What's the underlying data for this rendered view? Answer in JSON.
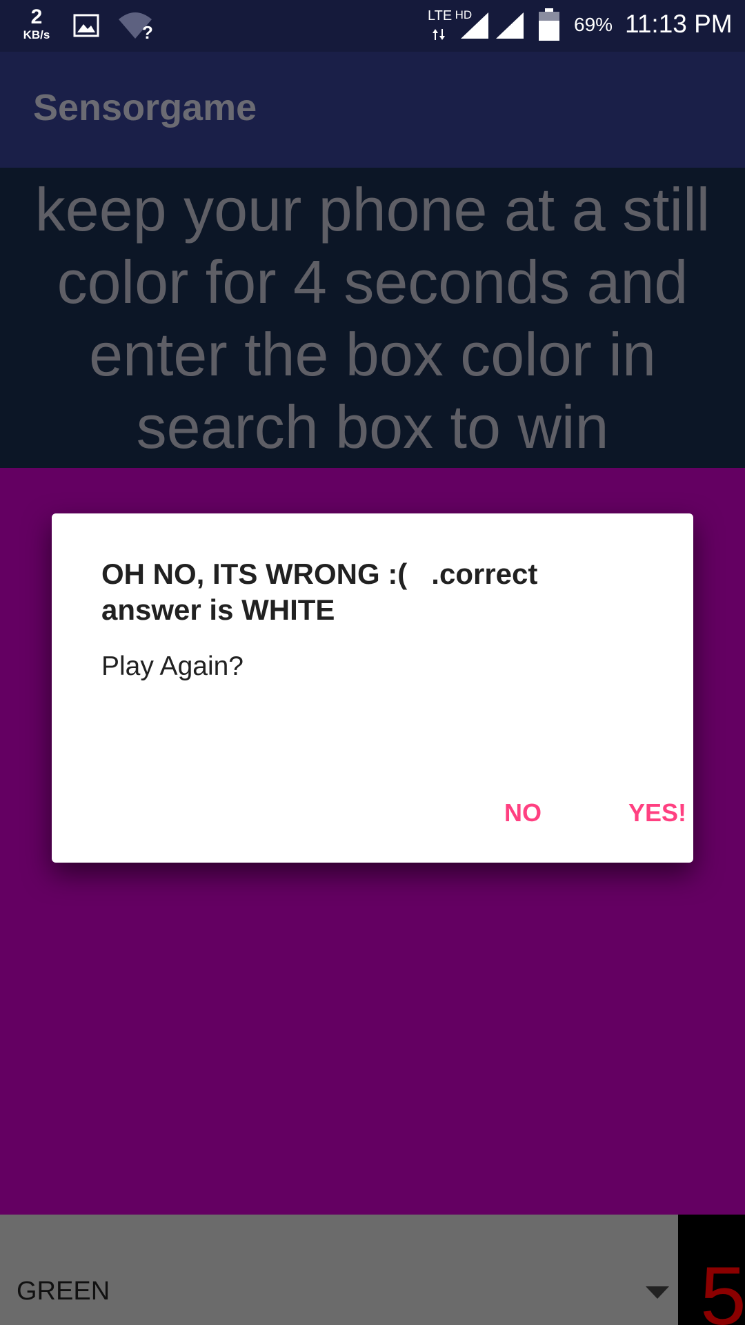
{
  "status_bar": {
    "speed_value": "2",
    "speed_unit": "KB/s",
    "network_type": "LTE",
    "network_quality": "HD",
    "battery_percent": "69%",
    "battery_level": 0.69,
    "time": "11:13 PM",
    "icons": [
      "gallery-icon",
      "wifi-unknown-icon",
      "lte-icon",
      "signal-icon",
      "signal-icon",
      "battery-icon"
    ]
  },
  "app_bar": {
    "title": "Sensorgame"
  },
  "game": {
    "instruction": "keep your phone at a still color for 4 seconds and enter the box color in search box to win",
    "box_color": "#640062"
  },
  "dialog": {
    "title": "OH NO, ITS WRONG :(   .correct answer is WHITE",
    "message": "Play Again?",
    "negative_label": "NO",
    "positive_label": "YES!",
    "accent_color": "#ff4081"
  },
  "bottom_bar": {
    "selected_color": "GREEN",
    "counter": "5"
  }
}
